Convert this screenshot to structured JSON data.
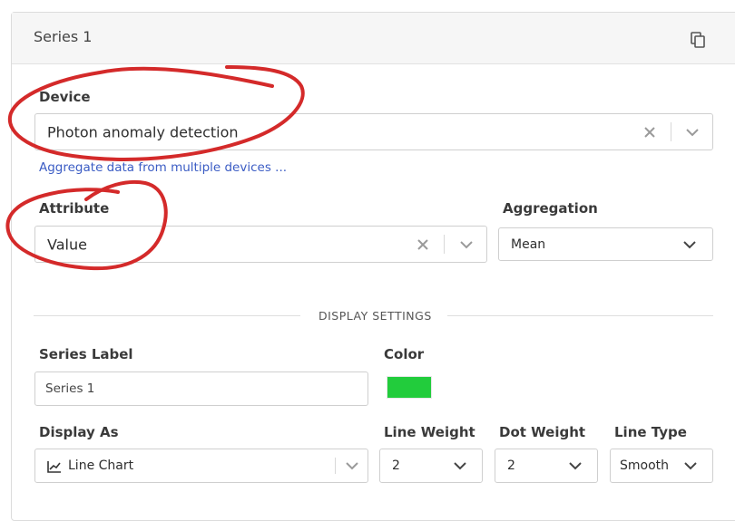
{
  "panel": {
    "title": "Series 1",
    "copy_icon": "copy-icon"
  },
  "device": {
    "label": "Device",
    "value": "Photon anomaly detection",
    "link": "Aggregate data from multiple devices ..."
  },
  "attribute": {
    "label": "Attribute",
    "value": "Value"
  },
  "aggregation": {
    "label": "Aggregation",
    "value": "Mean"
  },
  "display_settings": {
    "heading": "DISPLAY SETTINGS",
    "series_label": {
      "label": "Series Label",
      "value": "Series 1"
    },
    "color": {
      "label": "Color",
      "value": "#22cc3c"
    },
    "display_as": {
      "label": "Display As",
      "value": "Line Chart",
      "icon": "line-chart-icon"
    },
    "line_weight": {
      "label": "Line Weight",
      "value": "2"
    },
    "dot_weight": {
      "label": "Dot Weight",
      "value": "2"
    },
    "line_type": {
      "label": "Line Type",
      "value": "Smooth"
    }
  },
  "annotation_color": "#d42a2a"
}
